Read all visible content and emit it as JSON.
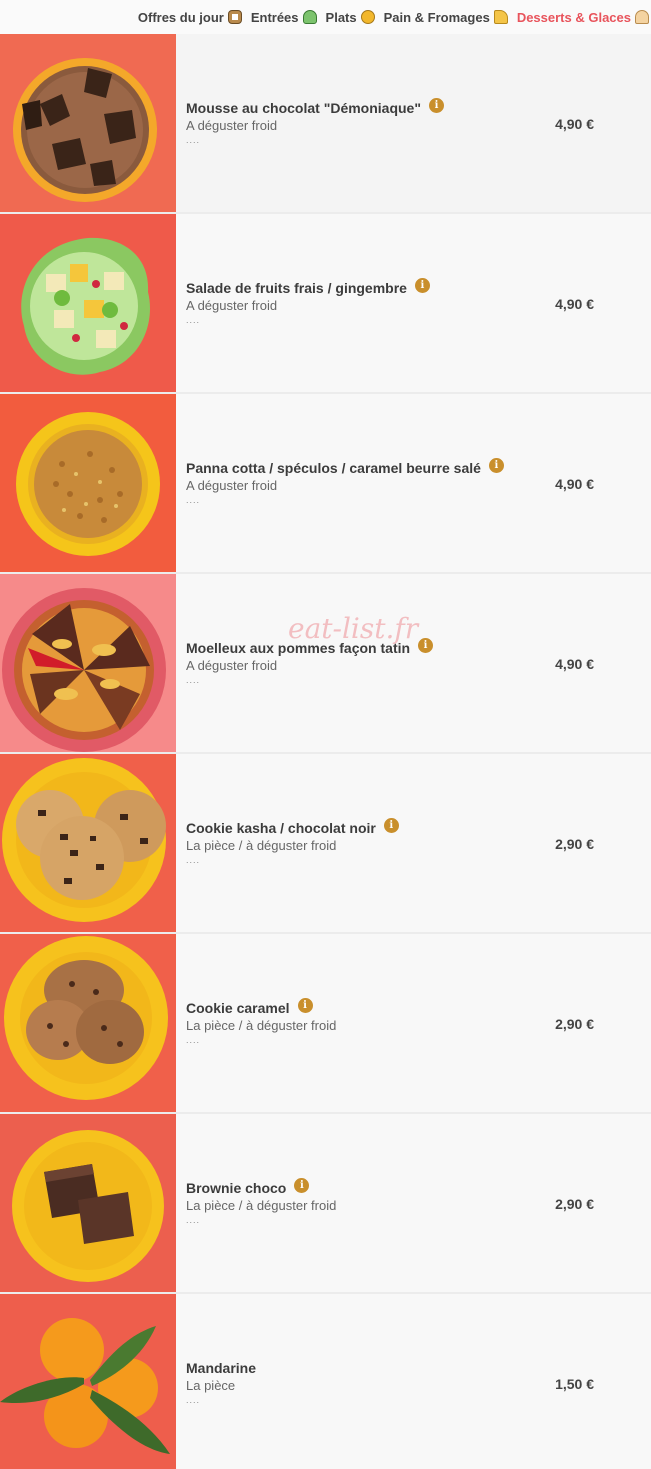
{
  "nav": {
    "tabs": [
      {
        "label": "Offres du jour",
        "icon": "clipboard-icon"
      },
      {
        "label": "Entrées",
        "icon": "salad-icon"
      },
      {
        "label": "Plats",
        "icon": "plate-icon"
      },
      {
        "label": "Pain & Fromages",
        "icon": "cheese-icon"
      },
      {
        "label": "Desserts & Glaces",
        "icon": "ice-cream-icon",
        "active": true
      }
    ]
  },
  "items": [
    {
      "name": "Mousse au chocolat \"Démoniaque\"",
      "desc": "A déguster froid",
      "dots": "....",
      "price": "4,90 €",
      "info": true
    },
    {
      "name": "Salade de fruits frais / gingembre",
      "desc": "A déguster froid",
      "dots": "....",
      "price": "4,90 €",
      "info": true
    },
    {
      "name": "Panna cotta / spéculos / caramel beurre salé",
      "desc": "A déguster froid",
      "dots": "....",
      "price": "4,90 €",
      "info": true
    },
    {
      "name": "Moelleux aux pommes façon tatin",
      "desc": "A déguster froid",
      "dots": "....",
      "price": "4,90 €",
      "info": true
    },
    {
      "name": "Cookie kasha / chocolat noir",
      "desc": "La pièce / à déguster froid",
      "dots": "....",
      "price": "2,90 €",
      "info": true
    },
    {
      "name": "Cookie caramel",
      "desc": "La pièce / à déguster froid",
      "dots": "....",
      "price": "2,90 €",
      "info": true
    },
    {
      "name": "Brownie choco",
      "desc": "La pièce / à déguster froid",
      "dots": "....",
      "price": "2,90 €",
      "info": true
    },
    {
      "name": "Mandarine",
      "desc": "La pièce",
      "dots": "....",
      "price": "1,50 €",
      "info": false
    }
  ],
  "info_glyph": "i",
  "watermark": "eat-list.fr",
  "colors": {
    "accent": "#e8545c",
    "info": "#c98f2c"
  }
}
